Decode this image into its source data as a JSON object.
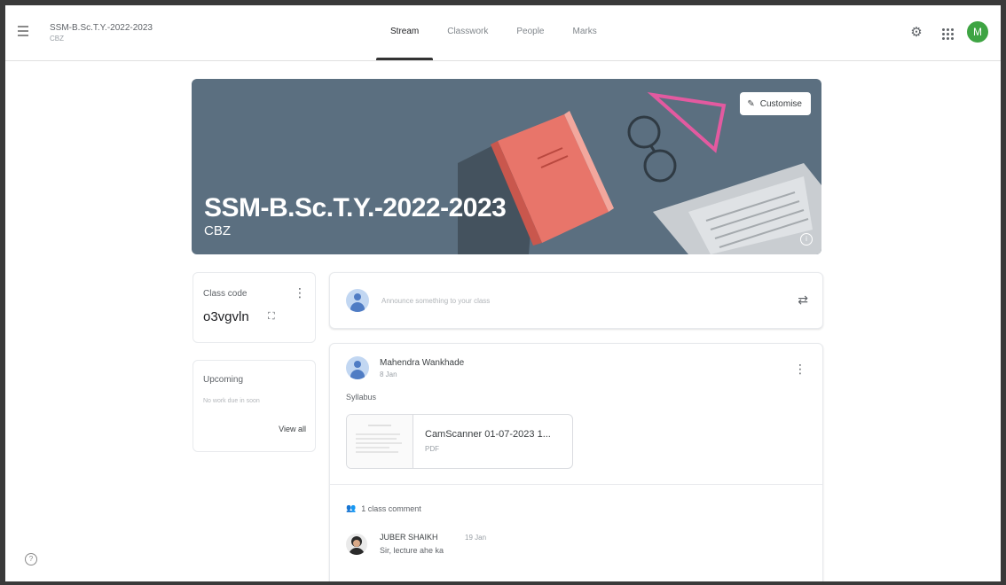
{
  "header": {
    "class_name": "SSM-B.Sc.T.Y.-2022-2023",
    "class_section": "CBZ",
    "avatar_letter": "M",
    "avatar_color": "#3ea443",
    "icons": [
      "menu-icon",
      "gear-icon",
      "apps-grid-icon"
    ]
  },
  "tabs": [
    {
      "label": "Stream",
      "active": true
    },
    {
      "label": "Classwork",
      "active": false
    },
    {
      "label": "People",
      "active": false
    },
    {
      "label": "Marks",
      "active": false
    }
  ],
  "banner": {
    "title": "SSM-B.Sc.T.Y.-2022-2023",
    "subtitle": "CBZ",
    "customise_label": "Customise",
    "background_color": "#5b6f80"
  },
  "class_code": {
    "label": "Class code",
    "value": "o3vgvln"
  },
  "upcoming": {
    "title": "Upcoming",
    "empty_text": "No work due in soon",
    "view_all_label": "View all"
  },
  "announce": {
    "placeholder": "Announce something to your class"
  },
  "post": {
    "author": "Mahendra Wankhade",
    "date": "8 Jan",
    "body": "Syllabus",
    "attachment": {
      "name": "CamScanner 01-07-2023 1...",
      "type": "PDF"
    },
    "comment_count": "1 class comment",
    "comment": {
      "author": "JUBER SHAIKH",
      "date": "19 Jan",
      "text": "Sir, lecture ahe ka"
    }
  }
}
